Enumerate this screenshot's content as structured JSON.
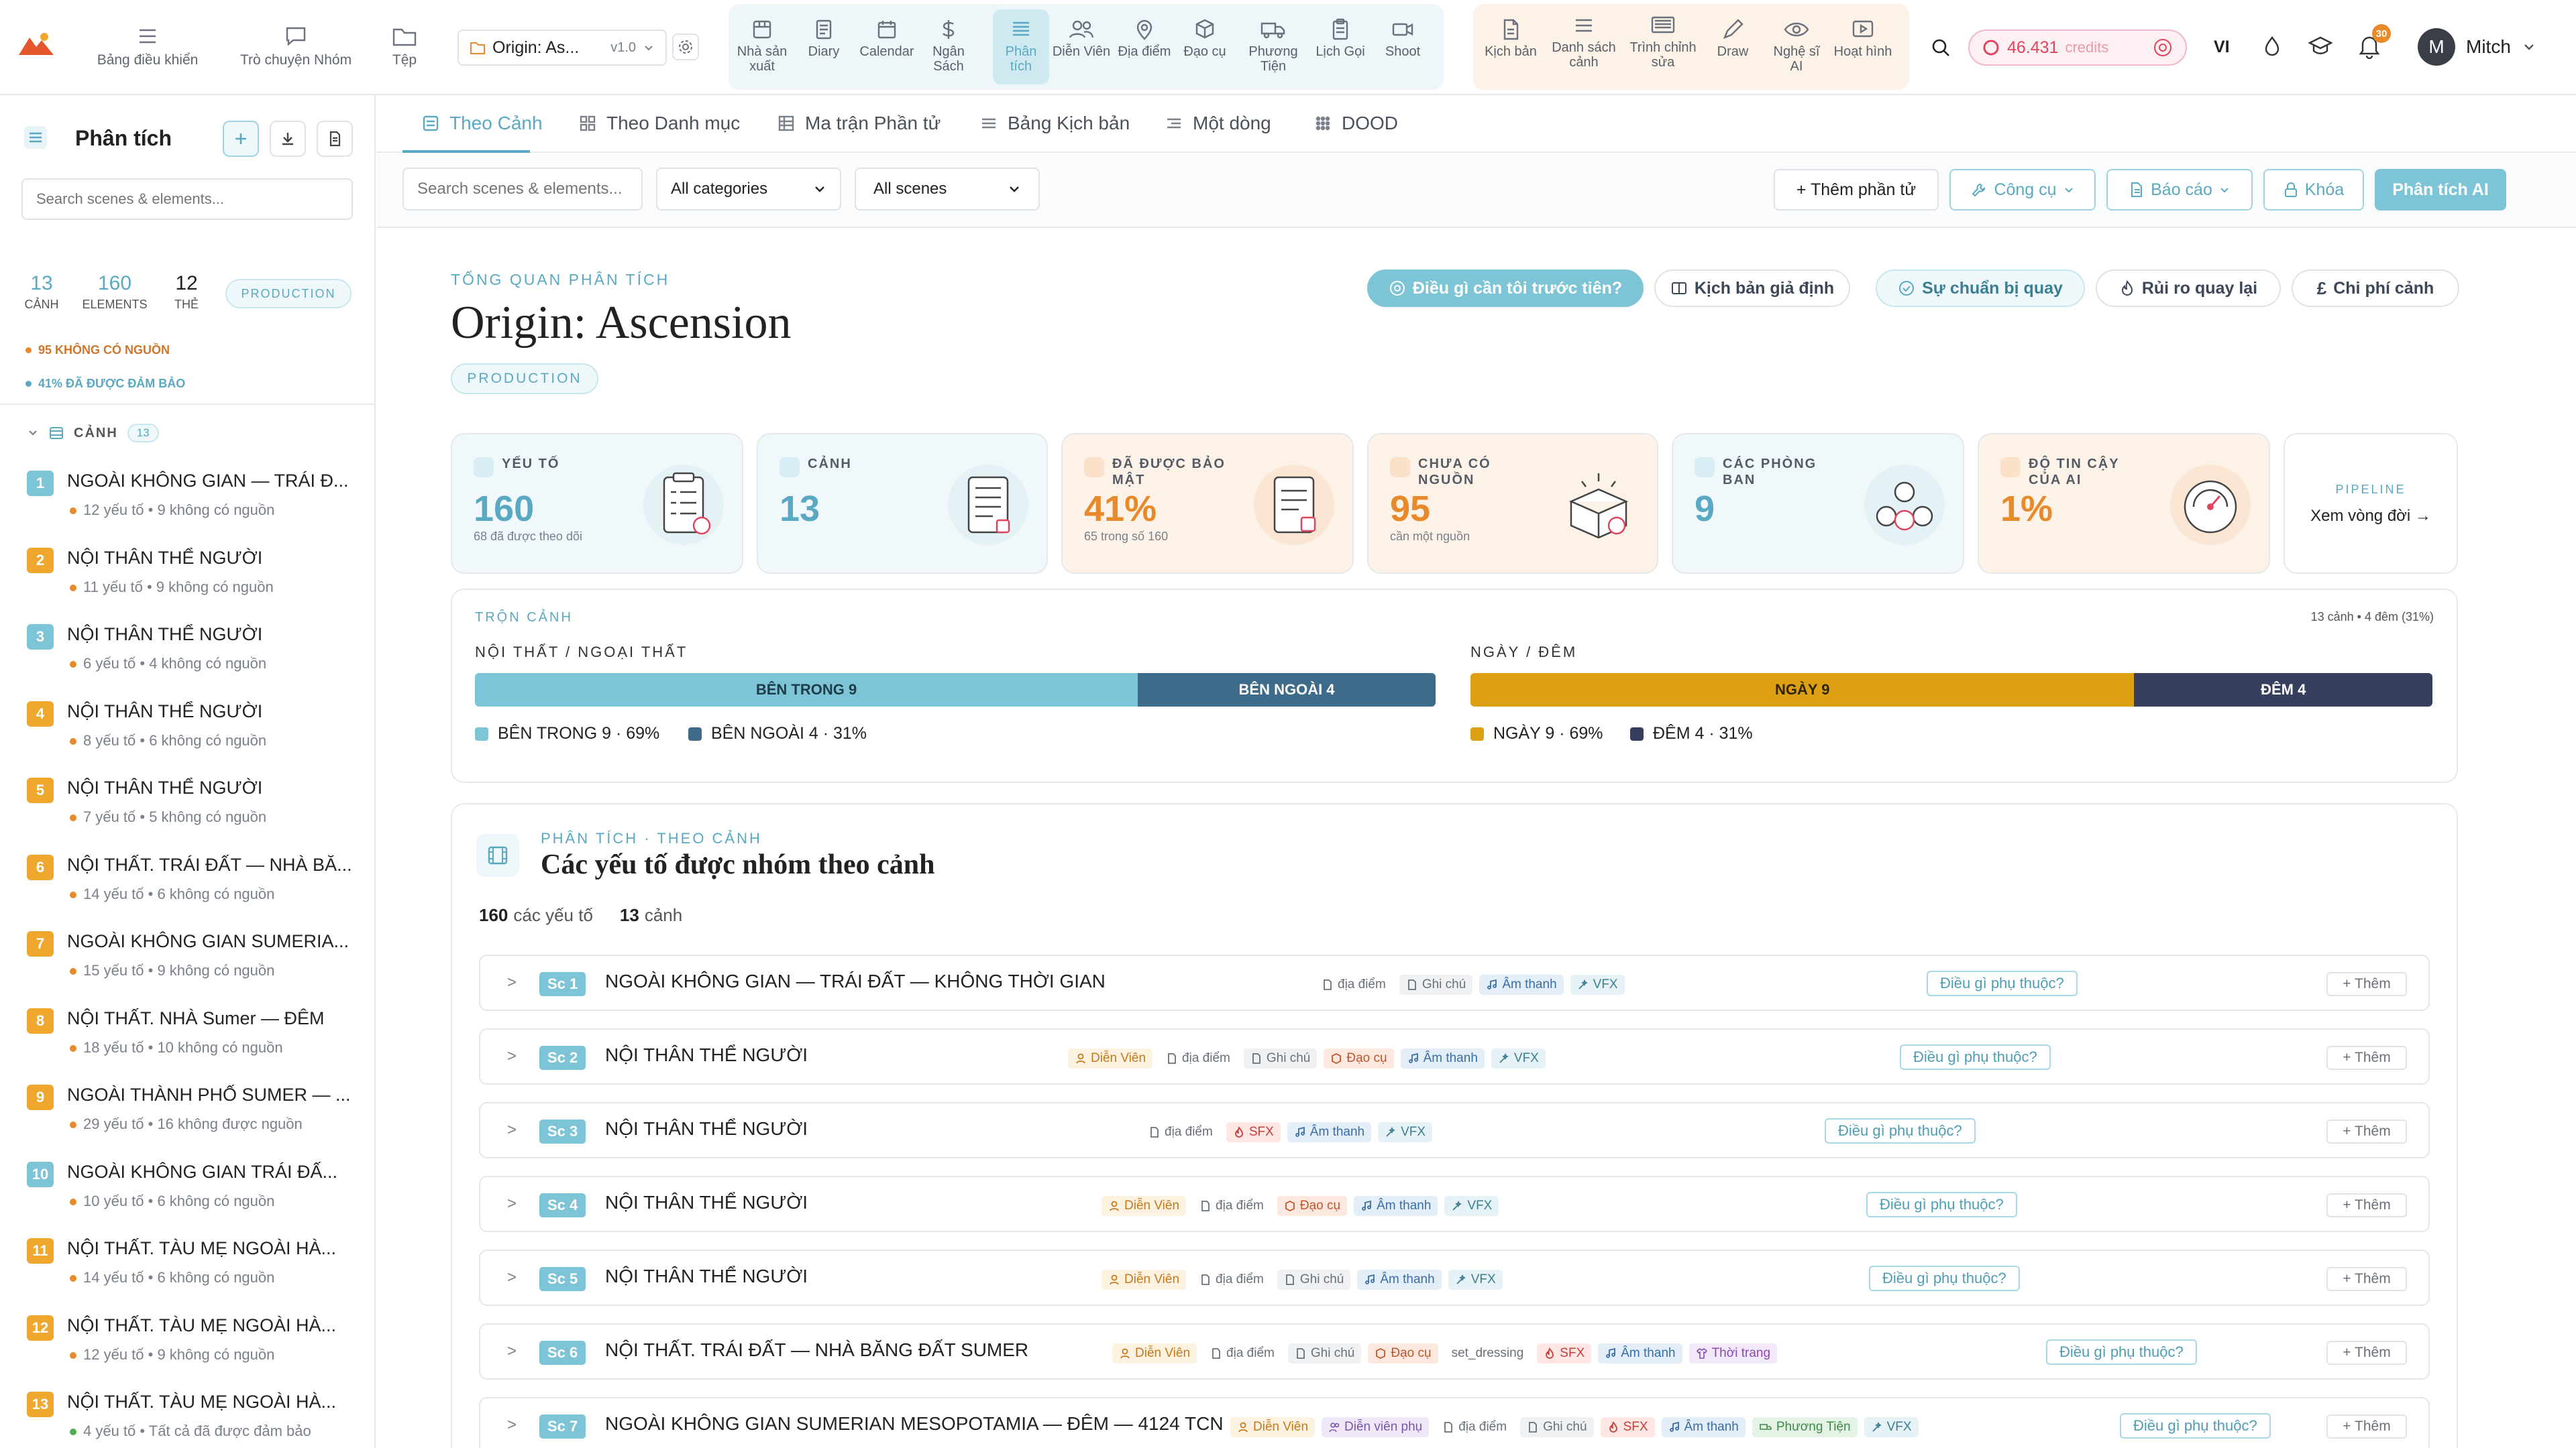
{
  "nav": {
    "items": [
      {
        "label": "Bảng điều khiển",
        "icon": "menu-icon"
      },
      {
        "label": "Trò chuyện Nhóm",
        "icon": "chat-icon"
      },
      {
        "label": "Tệp",
        "icon": "folder-icon"
      }
    ],
    "project": {
      "name": "Origin: As...",
      "version": "v1.0"
    },
    "tools": [
      {
        "label": "Nhà sản xuất",
        "icon": "production-icon"
      },
      {
        "label": "Diary",
        "icon": "diary-icon"
      },
      {
        "label": "Calendar",
        "icon": "calendar-icon"
      },
      {
        "label": "Ngân Sách",
        "icon": "dollar-icon"
      },
      {
        "label": "Phân tích",
        "icon": "breakdown-icon",
        "active": true
      },
      {
        "label": "Diễn Viên",
        "icon": "cast-icon"
      },
      {
        "label": "Địa điểm",
        "icon": "location-icon"
      },
      {
        "label": "Đạo cụ",
        "icon": "box-icon"
      },
      {
        "label": "Phương Tiện",
        "icon": "truck-icon"
      },
      {
        "label": "Lịch Gọi",
        "icon": "clipboard-icon"
      },
      {
        "label": "Shoot",
        "icon": "camera-icon"
      }
    ],
    "tools2": [
      {
        "label": "Kịch bản",
        "icon": "script-icon"
      },
      {
        "label": "Danh sách cảnh",
        "icon": "list-icon"
      },
      {
        "label": "Trình chỉnh sửa",
        "icon": "editor-icon"
      },
      {
        "label": "Draw",
        "icon": "pen-icon"
      },
      {
        "label": "Nghệ sĩ AI",
        "icon": "eye-icon"
      },
      {
        "label": "Hoạt hình",
        "icon": "play-icon"
      }
    ],
    "credits": "46.431",
    "credits_label": "credits",
    "lang": "VI",
    "notif_count": "30",
    "user_initial": "M",
    "user_name": "Mitch"
  },
  "sidebar": {
    "title": "Phân tích",
    "search_placeholder": "Search scenes & elements...",
    "stats": [
      {
        "value": "13",
        "label": "CẢNH"
      },
      {
        "value": "160",
        "label": "ELEMENTS"
      },
      {
        "value": "12",
        "label": "THẺ"
      }
    ],
    "badge": "PRODUCTION",
    "warn1": "95 KHÔNG CÓ NGUỒN",
    "warn2": "41% ĐÃ ĐƯỢC ĐẢM BẢO",
    "section_label": "CẢNH",
    "section_count": "13",
    "scenes": [
      {
        "num": "1",
        "title": "NGOÀI KHÔNG GIAN — TRÁI Đ...",
        "meta": "12 yếu tố • 9 không có nguồn",
        "color": "teal"
      },
      {
        "num": "2",
        "title": "NỘI THÂN THỂ NGƯỜI",
        "meta": "11 yếu tố • 9 không có nguồn",
        "color": "orange"
      },
      {
        "num": "3",
        "title": "NỘI THÂN THỂ NGƯỜI",
        "meta": "6 yếu tố • 4 không có nguồn",
        "color": "teal"
      },
      {
        "num": "4",
        "title": "NỘI THÂN THỂ NGƯỜI",
        "meta": "8 yếu tố • 6 không có nguồn",
        "color": "orange"
      },
      {
        "num": "5",
        "title": "NỘI THÂN THỂ NGƯỜI",
        "meta": "7 yếu tố • 5 không có nguồn",
        "color": "orange"
      },
      {
        "num": "6",
        "title": "NỘI THẤT. TRÁI ĐẤT — NHÀ BĂ...",
        "meta": "14 yếu tố • 6 không có nguồn",
        "color": "orange"
      },
      {
        "num": "7",
        "title": "NGOÀI KHÔNG GIAN SUMERIA...",
        "meta": "15 yếu tố • 9 không có nguồn",
        "color": "orange"
      },
      {
        "num": "8",
        "title": "NỘI THẤT. NHÀ Sumer — ĐÊM",
        "meta": "18 yếu tố • 10 không có nguồn",
        "color": "orange"
      },
      {
        "num": "9",
        "title": "NGOÀI THÀNH PHỐ SUMER — ...",
        "meta": "29 yếu tố • 16 không được nguồn",
        "color": "orange"
      },
      {
        "num": "10",
        "title": "NGOÀI KHÔNG GIAN TRÁI ĐẤ...",
        "meta": "10 yếu tố • 6 không có nguồn",
        "color": "teal"
      },
      {
        "num": "11",
        "title": "NỘI THẤT. TÀU MẸ NGOÀI HÀ...",
        "meta": "14 yếu tố • 6 không có nguồn",
        "color": "orange"
      },
      {
        "num": "12",
        "title": "NỘI THẤT. TÀU MẸ NGOÀI HÀ...",
        "meta": "12 yếu tố • 9 không có nguồn",
        "color": "orange"
      },
      {
        "num": "13",
        "title": "NỘI THẤT. TÀU MẸ NGOÀI HÀ...",
        "meta": "4 yếu tố • Tất cả đã được đảm bảo",
        "color": "orange"
      }
    ]
  },
  "tabs": [
    "Theo Cảnh",
    "Theo Danh mục",
    "Ma trận Phần tử",
    "Bảng Kịch bản",
    "Một dòng",
    "DOOD"
  ],
  "toolbar": {
    "search_placeholder": "Search scenes & elements...",
    "category_select": "All categories",
    "scene_select": "All scenes",
    "add_button": "+ Thêm phần tử",
    "tools_button": "Công cụ",
    "report_button": "Báo cáo",
    "lock_button": "Khóa",
    "ai_button": "Phân tích AI"
  },
  "overview": {
    "eyebrow": "TỔNG QUAN PHÂN TÍCH",
    "title": "Origin: Ascension",
    "badge": "PRODUCTION",
    "pills": [
      "Điều gì cần tôi trước tiên?",
      "Kịch bản giả định",
      "Sự chuẩn bị quay",
      "Rủi ro quay lại",
      "Chi phí cảnh"
    ]
  },
  "stats": [
    {
      "label": "YẾU TỐ",
      "value": "160",
      "sub": "68 đã được theo dõi",
      "value_color": "#5aa9c2"
    },
    {
      "label": "CẢNH",
      "value": "13",
      "sub": "",
      "value_color": "#5aa9c2"
    },
    {
      "label": "ĐÃ ĐƯỢC BẢO MẬT",
      "value": "41%",
      "sub": "65 trong số 160",
      "value_color": "#e8892a"
    },
    {
      "label": "CHƯA CÓ NGUỒN",
      "value": "95",
      "sub": "cần một nguồn",
      "value_color": "#e8892a"
    },
    {
      "label": "CÁC PHÒNG BAN",
      "value": "9",
      "sub": "",
      "value_color": "#5aa9c2"
    },
    {
      "label": "ĐỘ TIN CẬY CỦA AI",
      "value": "1%",
      "sub": "",
      "value_color": "#e8892a"
    }
  ],
  "pipeline": {
    "label": "PIPELINE",
    "link": "Xem vòng đời →"
  },
  "mix": {
    "title": "TRỘN CẢNH",
    "summary": "13 cảnh • 4 đêm (31%)",
    "intext_label": "NỘI THẤT / NGOẠI THẤT",
    "int_bar": "BÊN TRONG 9",
    "ext_bar": "BÊN NGOÀI 4",
    "int_legend": "BÊN TRONG 9 · 69%",
    "ext_legend": "BÊN NGOÀI 4 · 31%",
    "int_fraction": 0.69,
    "daynight_label": "NGÀY / ĐÊM",
    "day_bar": "NGÀY 9",
    "night_bar": "ĐÊM 4",
    "day_legend": "NGÀY 9 · 69%",
    "night_legend": "ĐÊM 4 · 31%",
    "day_fraction": 0.69
  },
  "breakdown": {
    "eyebrow": "PHÂN TÍCH · THEO CẢNH",
    "title": "Các yếu tố được nhóm theo cảnh",
    "count_elements": "160",
    "count_elements_label": "các yếu tố",
    "count_scenes": "13",
    "count_scenes_label": "cảnh",
    "dep_label": "Điều gì phụ thuộc?",
    "add_label": "+ Thêm",
    "rows": [
      {
        "sc": "Sc 1",
        "title": "NGOÀI KHÔNG GIAN — TRÁI ĐẤT — KHÔNG THỜI GIAN",
        "chips": [
          [
            "dd",
            "địa điểm"
          ],
          [
            "gc",
            "Ghi chú"
          ],
          [
            "at",
            "Âm thanh"
          ],
          [
            "vfx",
            "VFX"
          ]
        ]
      },
      {
        "sc": "Sc 2",
        "title": "NỘI THÂN THỂ NGƯỜI",
        "chips": [
          [
            "dv",
            "Diễn Viên"
          ],
          [
            "dd",
            "địa điểm"
          ],
          [
            "gc",
            "Ghi chú"
          ],
          [
            "dc",
            "Đạo cụ"
          ],
          [
            "at",
            "Âm thanh"
          ],
          [
            "vfx",
            "VFX"
          ]
        ]
      },
      {
        "sc": "Sc 3",
        "title": "NỘI THÂN THỂ NGƯỜI",
        "chips": [
          [
            "dd",
            "địa điểm"
          ],
          [
            "sfx",
            "SFX"
          ],
          [
            "at",
            "Âm thanh"
          ],
          [
            "vfx",
            "VFX"
          ]
        ]
      },
      {
        "sc": "Sc 4",
        "title": "NỘI THÂN THỂ NGƯỜI",
        "chips": [
          [
            "dv",
            "Diễn Viên"
          ],
          [
            "dd",
            "địa điểm"
          ],
          [
            "dc",
            "Đạo cụ"
          ],
          [
            "at",
            "Âm thanh"
          ],
          [
            "vfx",
            "VFX"
          ]
        ]
      },
      {
        "sc": "Sc 5",
        "title": "NỘI THÂN THỂ NGƯỜI",
        "chips": [
          [
            "dv",
            "Diễn Viên"
          ],
          [
            "dd",
            "địa điểm"
          ],
          [
            "gc",
            "Ghi chú"
          ],
          [
            "at",
            "Âm thanh"
          ],
          [
            "vfx",
            "VFX"
          ]
        ]
      },
      {
        "sc": "Sc 6",
        "title": "NỘI THẤT. TRÁI ĐẤT — NHÀ BĂNG ĐẤT SUMER",
        "chips": [
          [
            "dv",
            "Diễn Viên"
          ],
          [
            "dd",
            "địa điểm"
          ],
          [
            "gc",
            "Ghi chú"
          ],
          [
            "dc",
            "Đạo cụ"
          ],
          [
            "sd",
            "set_dressing"
          ],
          [
            "sfx",
            "SFX"
          ],
          [
            "at",
            "Âm thanh"
          ],
          [
            "tt",
            "Thời trang"
          ]
        ]
      },
      {
        "sc": "Sc 7",
        "title": "NGOÀI KHÔNG GIAN SUMERIAN MESOPOTAMIA — ĐÊM — 4124 TCN",
        "chips": [
          [
            "dv",
            "Diễn Viên"
          ],
          [
            "dvp",
            "Diễn viên phụ"
          ],
          [
            "dd",
            "địa điểm"
          ],
          [
            "gc",
            "Ghi chú"
          ],
          [
            "sfx",
            "SFX"
          ],
          [
            "at",
            "Âm thanh"
          ],
          [
            "pt",
            "Phương Tiện"
          ],
          [
            "vfx",
            "VFX"
          ]
        ]
      }
    ]
  }
}
